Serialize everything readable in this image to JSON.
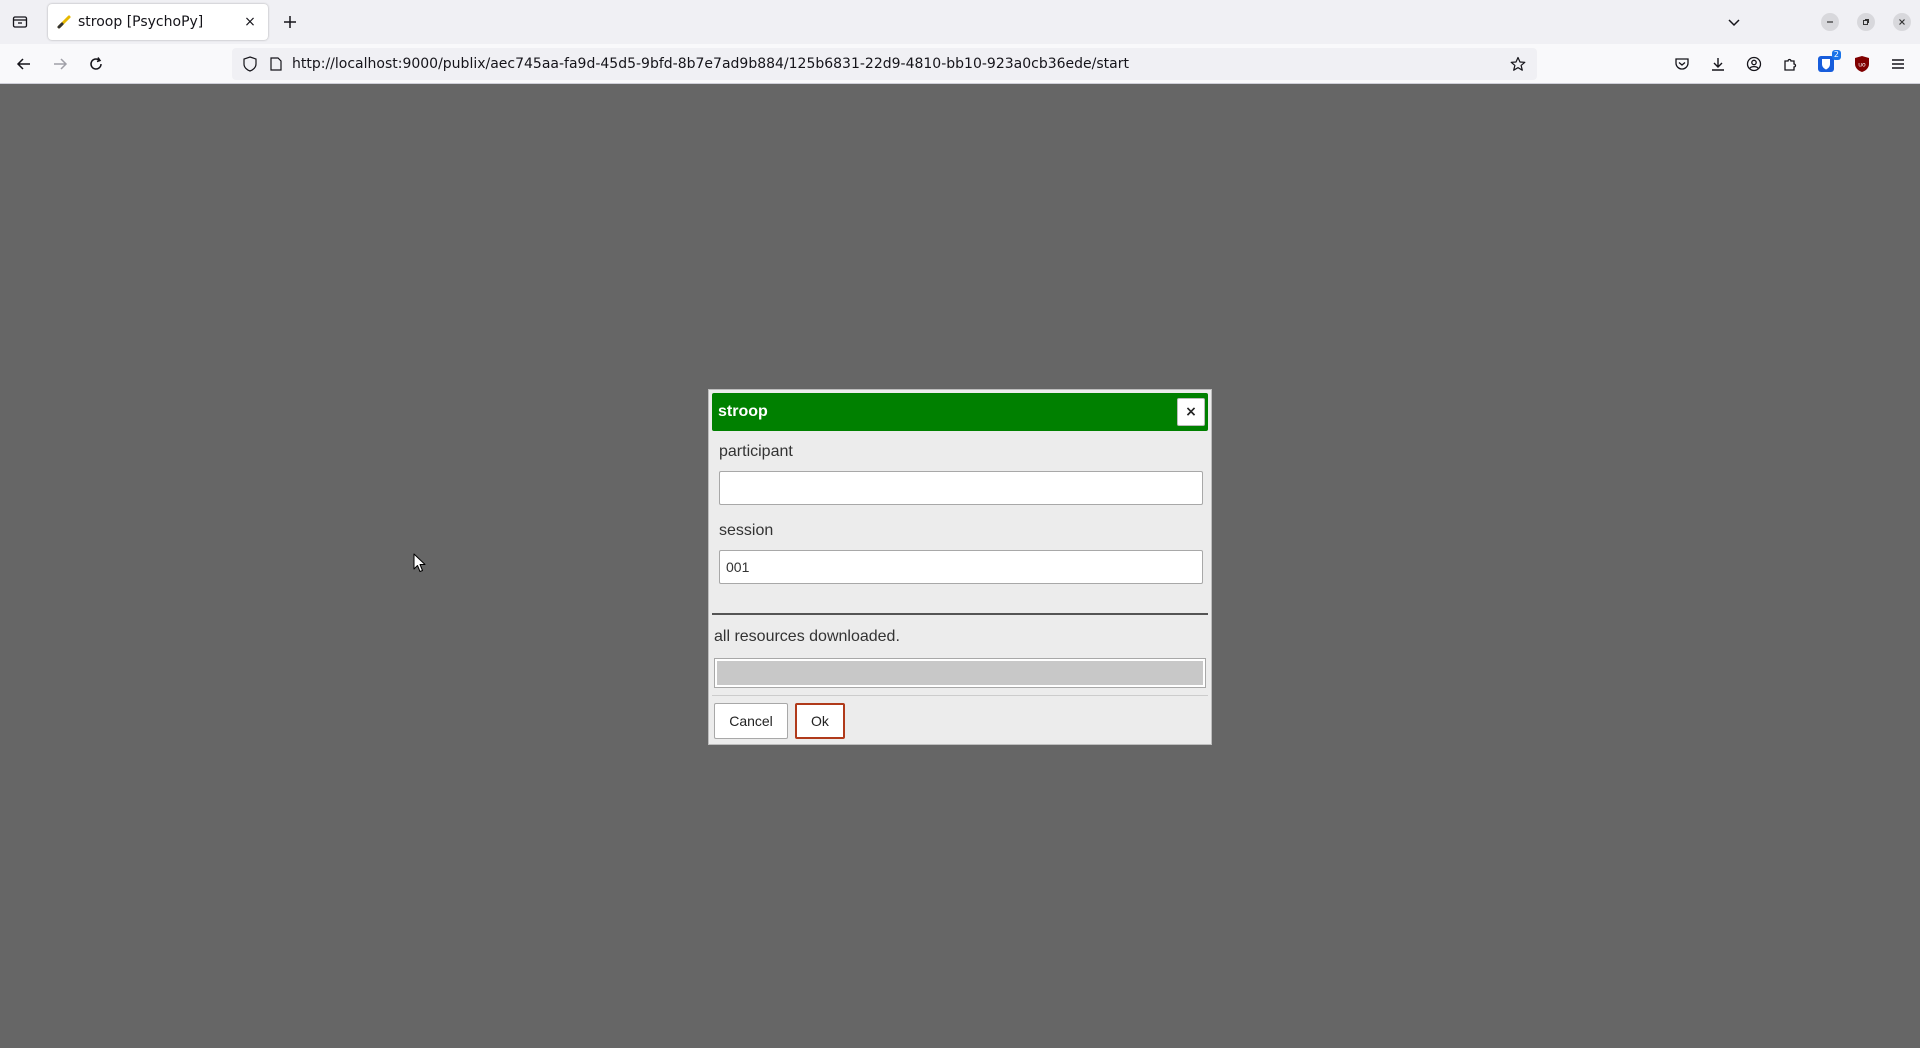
{
  "browser": {
    "tab_title": "stroop [PsychoPy]",
    "tab_close": "×",
    "url": "http://localhost:9000/publix/aec745aa-fa9d-45d5-9bfd-8b7e7ad9b884/125b6831-22d9-4810-bb10-923a0cb36ede/start",
    "extension_badge": "2"
  },
  "dialog": {
    "title": "stroop",
    "close_label": "×",
    "fields": [
      {
        "label": "participant",
        "value": ""
      },
      {
        "label": "session",
        "value": "001"
      }
    ],
    "status": "all resources downloaded.",
    "progress": 1.0,
    "cancel_label": "Cancel",
    "ok_label": "Ok"
  },
  "colors": {
    "titlebar": "#008000",
    "page_background": "#666666",
    "ok_border": "#b03a1a"
  }
}
